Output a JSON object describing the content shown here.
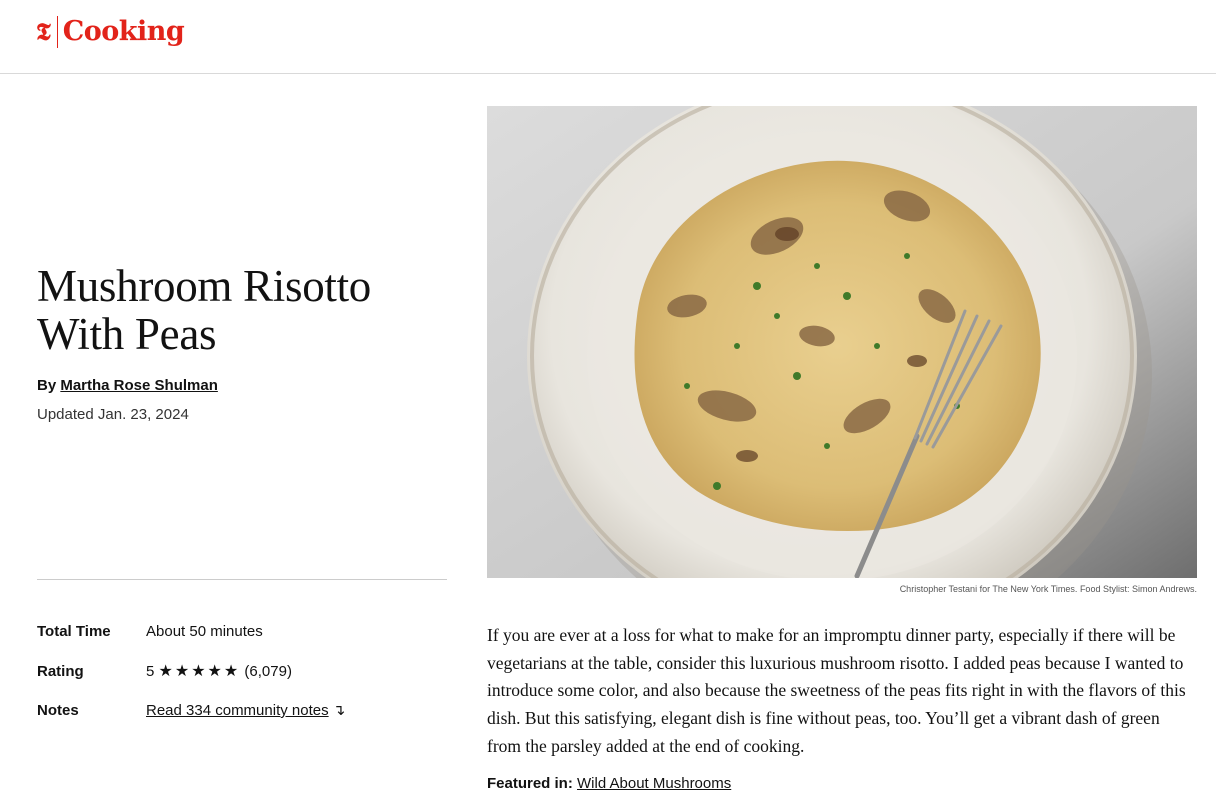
{
  "header": {
    "logo_mark": "𝕿",
    "logo_text": "Cooking"
  },
  "recipe": {
    "title": "Mushroom Risotto With Peas",
    "byline_prefix": "By ",
    "author": "Martha Rose Shulman",
    "updated": "Updated Jan. 23, 2024",
    "photo_credit": "Christopher Testani for The New York Times. Food Stylist: Simon Andrews.",
    "description": "If you are ever at a loss for what to make for an impromptu dinner party, especially if there will be vegetarians at the table, consider this luxurious mushroom risotto. I added peas because I wanted to introduce some color, and also because the sweetness of the peas fits right in with the flavors of this dish. But this satisfying, elegant dish is fine without peas, too. You’ll get a vibrant dash of green from the parsley added at the end of cooking.",
    "featured_label": "Featured in:",
    "featured_link": "Wild About Mushrooms"
  },
  "meta": {
    "total_time_label": "Total Time",
    "total_time_value": "About 50 minutes",
    "rating_label": "Rating",
    "rating_value": "5",
    "rating_stars": "★★★★★",
    "rating_count": "(6,079)",
    "notes_label": "Notes",
    "notes_link": "Read 334 community notes",
    "notes_arrow": "↴"
  },
  "colors": {
    "brand_red": "#e2231a"
  }
}
